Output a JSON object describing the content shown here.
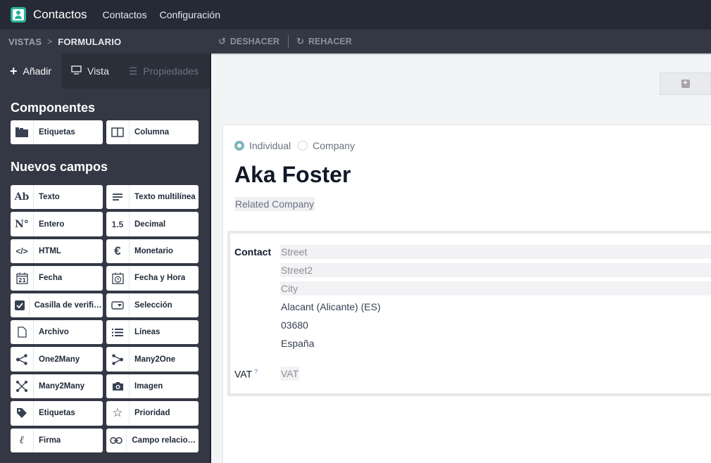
{
  "app": {
    "title": "Contactos"
  },
  "topnav": {
    "items": [
      "Contactos",
      "Configuración"
    ]
  },
  "breadcrumb": {
    "parent": "VISTAS",
    "separator": ">",
    "current": "FORMULARIO"
  },
  "toolbar": {
    "undo_label": "DESHACER",
    "redo_label": "REHACER"
  },
  "sidebar": {
    "tabs": {
      "add": "Añadir",
      "view": "Vista",
      "properties": "Propiedades"
    },
    "components_title": "Componentes",
    "components": [
      {
        "label": "Etiquetas",
        "icon": "notebook-tabs-icon"
      },
      {
        "label": "Columna",
        "icon": "columns-icon"
      }
    ],
    "new_fields_title": "Nuevos campos",
    "fields": [
      {
        "label": "Texto",
        "icon": "text-icon"
      },
      {
        "label": "Texto multilínea",
        "icon": "multiline-text-icon"
      },
      {
        "label": "Entero",
        "icon": "integer-icon"
      },
      {
        "label": "Decimal",
        "icon": "decimal-icon"
      },
      {
        "label": "HTML",
        "icon": "code-icon"
      },
      {
        "label": "Monetario",
        "icon": "euro-icon"
      },
      {
        "label": "Fecha",
        "icon": "calendar-icon"
      },
      {
        "label": "Fecha y Hora",
        "icon": "calendar-clock-icon"
      },
      {
        "label": "Casilla de verificación",
        "icon": "checkbox-icon"
      },
      {
        "label": "Selección",
        "icon": "selection-icon"
      },
      {
        "label": "Archivo",
        "icon": "file-icon"
      },
      {
        "label": "Líneas",
        "icon": "list-icon"
      },
      {
        "label": "One2Many",
        "icon": "one2many-icon"
      },
      {
        "label": "Many2One",
        "icon": "many2one-icon"
      },
      {
        "label": "Many2Many",
        "icon": "many2many-icon"
      },
      {
        "label": "Imagen",
        "icon": "camera-icon"
      },
      {
        "label": "Etiquetas",
        "icon": "tag-icon"
      },
      {
        "label": "Prioridad",
        "icon": "star-icon"
      },
      {
        "label": "Firma",
        "icon": "signature-icon"
      },
      {
        "label": "Campo relacionado",
        "icon": "link-icon"
      }
    ]
  },
  "form": {
    "company_type": {
      "options": [
        "Individual",
        "Company"
      ],
      "selected": "Individual"
    },
    "name": "Aka Foster",
    "related_company_placeholder": "Related Company",
    "contact_label": "Contact",
    "address": {
      "street_placeholder": "Street",
      "street2_placeholder": "Street2",
      "city_placeholder": "City",
      "state": "Alacant (Alicante) (ES)",
      "zip": "03680",
      "country": "España"
    },
    "vat_label": "VAT",
    "vat_help": "?",
    "vat_placeholder": "VAT"
  },
  "colors": {
    "topbar": "#262a36",
    "sidebar": "#343845",
    "accent": "#2bb39c",
    "radio_checked": "#7fb5bd"
  }
}
